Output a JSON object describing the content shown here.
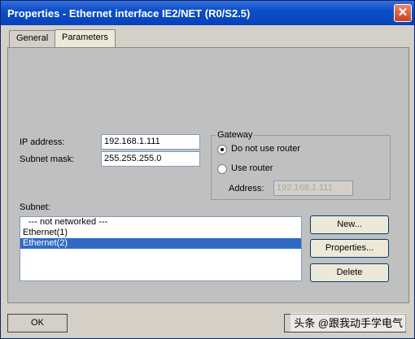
{
  "window": {
    "title": "Properties - Ethernet interface  IE2/NET (R0/S2.5)",
    "close_glyph": "✕"
  },
  "tabs": [
    {
      "label": "General"
    },
    {
      "label": "Parameters"
    }
  ],
  "ip": {
    "label": "IP address:",
    "value": "192.168.1.111"
  },
  "mask": {
    "label": "Subnet mask:",
    "value": "255.255.255.0"
  },
  "gateway": {
    "title": "Gateway",
    "option_no_router": "Do not use router",
    "option_use_router": "Use router",
    "address_label": "Address:",
    "address_value": "192.168.1.111",
    "selected": "Do not use router"
  },
  "subnet": {
    "label": "Subnet:",
    "items": [
      "--- not networked ---",
      "Ethernet(1)",
      "Ethernet(2)"
    ],
    "selected": "Ethernet(2)"
  },
  "buttons": {
    "new": "New...",
    "properties": "Properties...",
    "delete": "Delete",
    "ok": "OK"
  },
  "watermark": "头条 @跟我动手学电气"
}
